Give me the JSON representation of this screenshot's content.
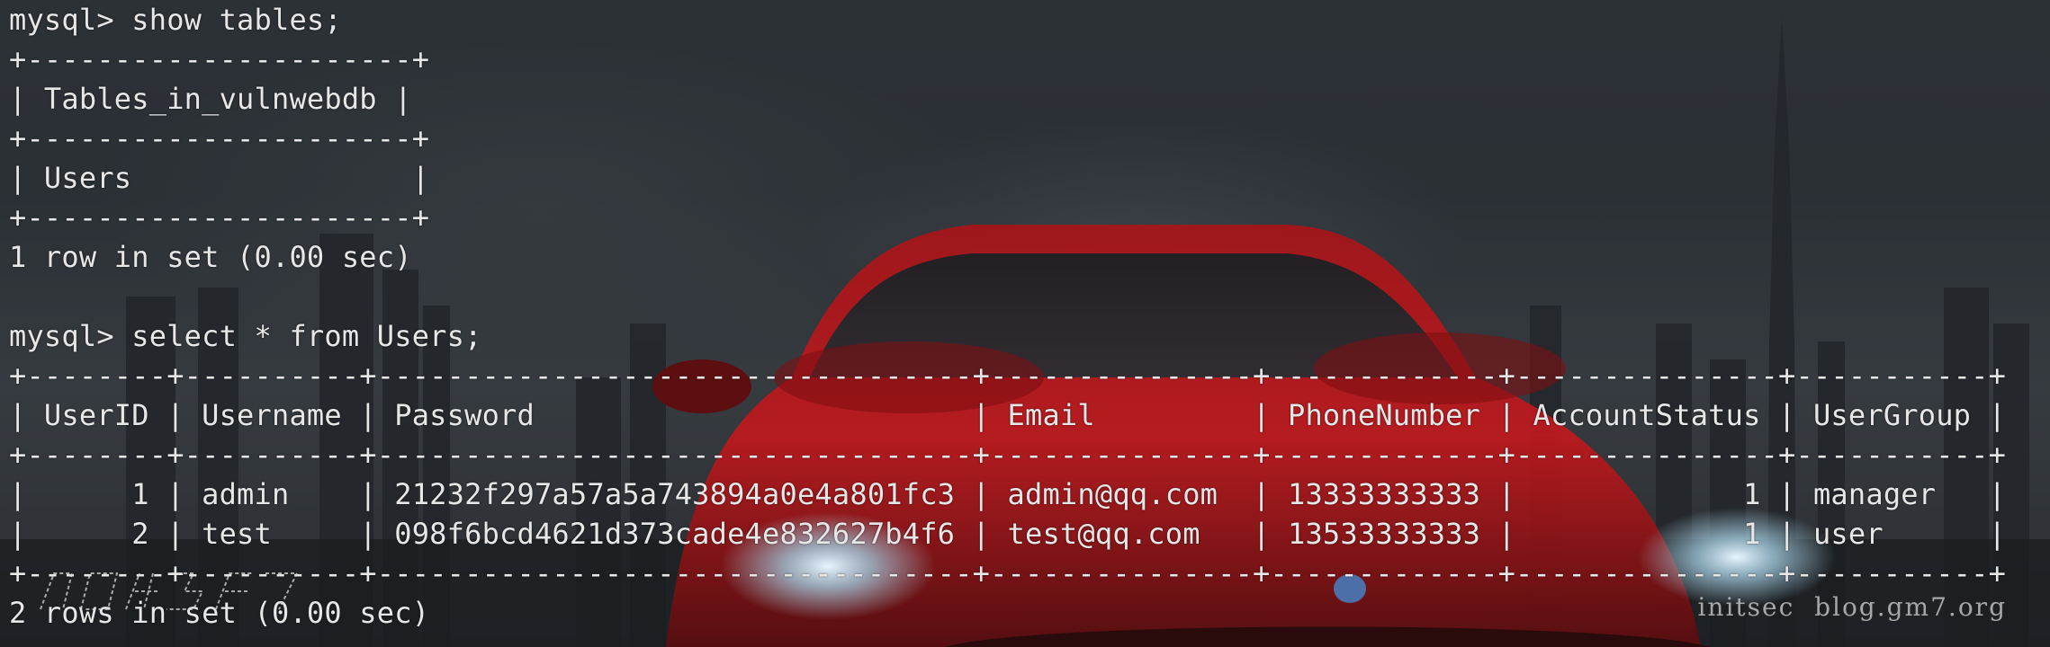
{
  "colors": {
    "background": "#2b3035",
    "text": "#e7e7e7",
    "car": "#b9191c",
    "watermark": "#bfbfbf"
  },
  "terminal": {
    "lines": [
      "mysql> show tables;",
      "+----------------------+",
      "| Tables_in_vulnwebdb |",
      "+----------------------+",
      "| Users                |",
      "+----------------------+",
      "1 row in set (0.00 sec)",
      "",
      "mysql> select * from Users;",
      "+--------+----------+----------------------------------+---------------+-------------+---------------+-----------+",
      "| UserID | Username | Password                         | Email         | PhoneNumber | AccountStatus | UserGroup |",
      "+--------+----------+----------------------------------+---------------+-------------+---------------+-----------+",
      "|      1 | admin    | 21232f297a57a5a743894a0e4a801fc3 | admin@qq.com  | 13333333333 |             1 | manager   |",
      "|      2 | test     | 098f6bcd4621d373cade4e832627b4f6 | test@qq.com   | 13533333333 |             1 | user      |",
      "+--------+----------+----------------------------------+---------------+-------------+---------------+-----------+",
      "2 rows in set (0.00 sec)"
    ]
  },
  "watermark": {
    "text": "initsec  blog.gm7.org"
  }
}
